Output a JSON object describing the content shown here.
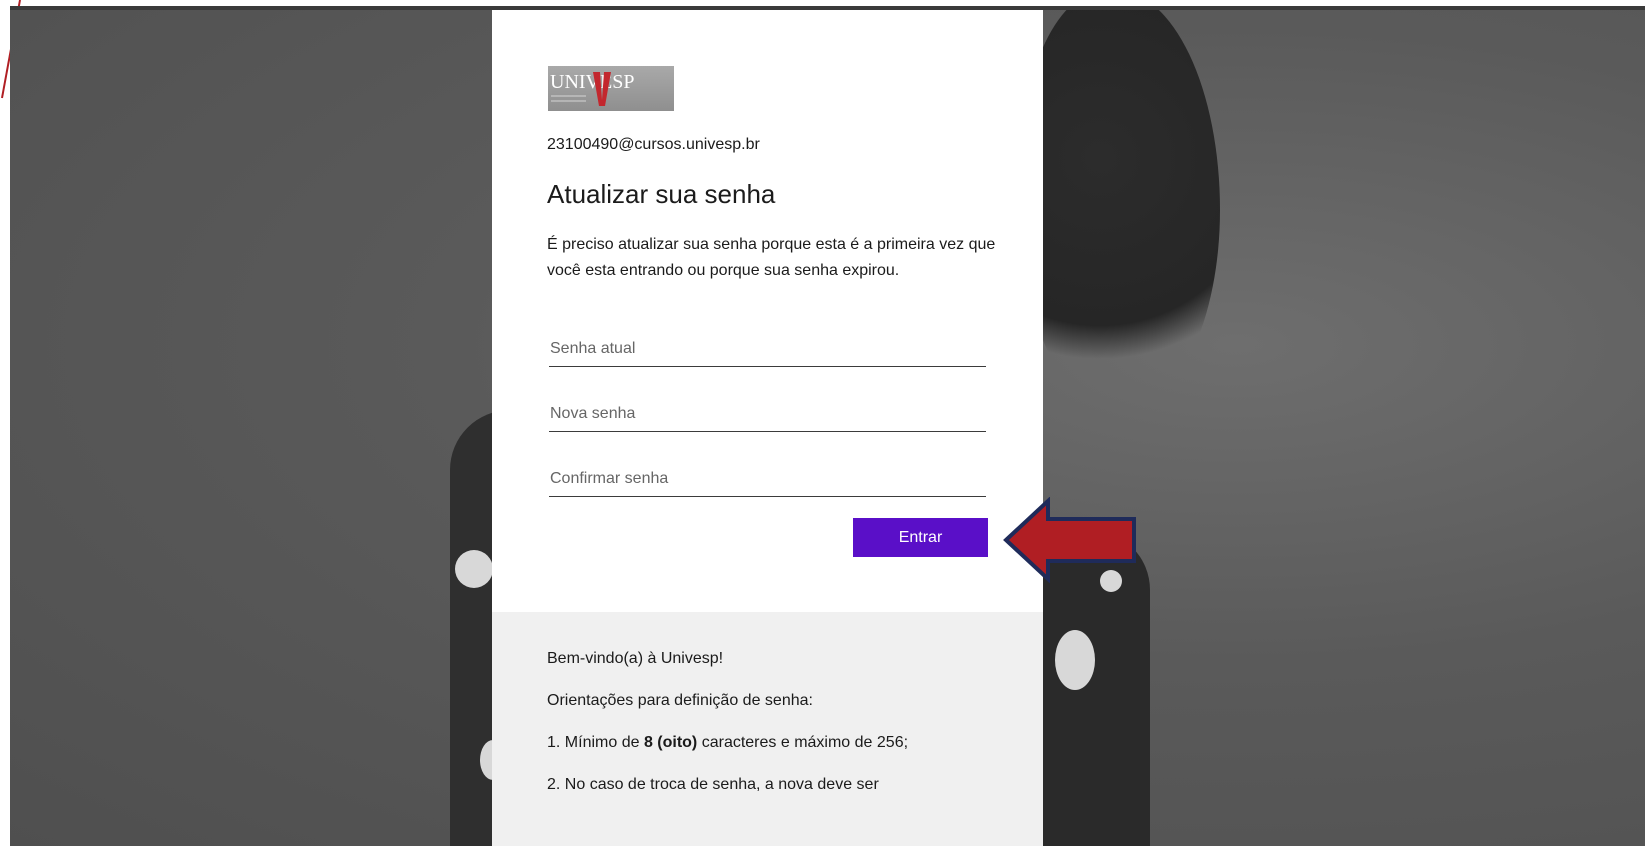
{
  "app": {
    "logo_text": "UNIVESP",
    "account_email": "23100490@cursos.univesp.br",
    "title": "Atualizar sua senha",
    "description": "É preciso atualizar sua senha porque esta é a primeira vez que você esta entrando ou porque sua senha expirou."
  },
  "form": {
    "current_password_placeholder": "Senha atual",
    "new_password_placeholder": "Nova senha",
    "confirm_password_placeholder": "Confirmar senha",
    "submit_label": "Entrar"
  },
  "footer": {
    "welcome": "Bem-vindo(a) à Univesp!",
    "guidelines_heading": "Orientações para definição de senha:",
    "rule1_prefix": "1. Mínimo de ",
    "rule1_bold": "8 (oito)",
    "rule1_suffix": " caracteres e máximo de 256;",
    "rule2": "2. No caso de troca de senha, a nova deve ser"
  },
  "colors": {
    "accent": "#5a0fc8",
    "annotation_arrow": "#b01e23",
    "annotation_outline": "#1f2b5a"
  }
}
